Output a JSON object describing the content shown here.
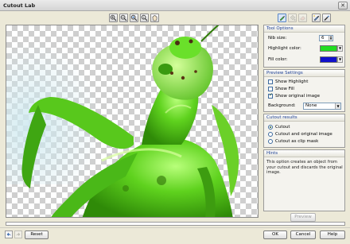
{
  "window": {
    "title": "Cutout Lab",
    "close_glyph": "✕"
  },
  "toolbar": {
    "view_icons": [
      "zoom-in-icon",
      "zoom-out-icon",
      "zoom-fit-icon",
      "zoom-actual-icon",
      "pan-icon"
    ],
    "tool_icons": [
      "highlighter-icon",
      "fill-icon",
      "eraser-icon",
      "smart-highlighter-icon",
      "preview-edit-icon"
    ]
  },
  "tool_options": {
    "header": "Tool Options",
    "nib_label": "Nib size:",
    "nib_value": "6",
    "highlight_label": "Highlight color:",
    "highlight_color": "#22dd22",
    "fill_label": "Fill color:",
    "fill_color": "#1010cc"
  },
  "preview_settings": {
    "header": "Preview Settings",
    "show_highlight": {
      "label": "Show Highlight",
      "checked": false
    },
    "show_fill": {
      "label": "Show Fill",
      "checked": false
    },
    "show_original": {
      "label": "Show original image",
      "checked": true
    },
    "background_label": "Background:",
    "background_value": "None"
  },
  "cutout_results": {
    "header": "Cutout results",
    "options": [
      {
        "label": "Cutout",
        "selected": true
      },
      {
        "label": "Cutout and original image",
        "selected": false
      },
      {
        "label": "Cutout as clip mask",
        "selected": false
      }
    ]
  },
  "hints": {
    "header": "Hints",
    "text": "This option creates an object from your cutout and discards the original image."
  },
  "buttons": {
    "preview": "Preview",
    "reset": "Reset",
    "ok": "OK",
    "cancel": "Cancel",
    "help": "Help"
  }
}
